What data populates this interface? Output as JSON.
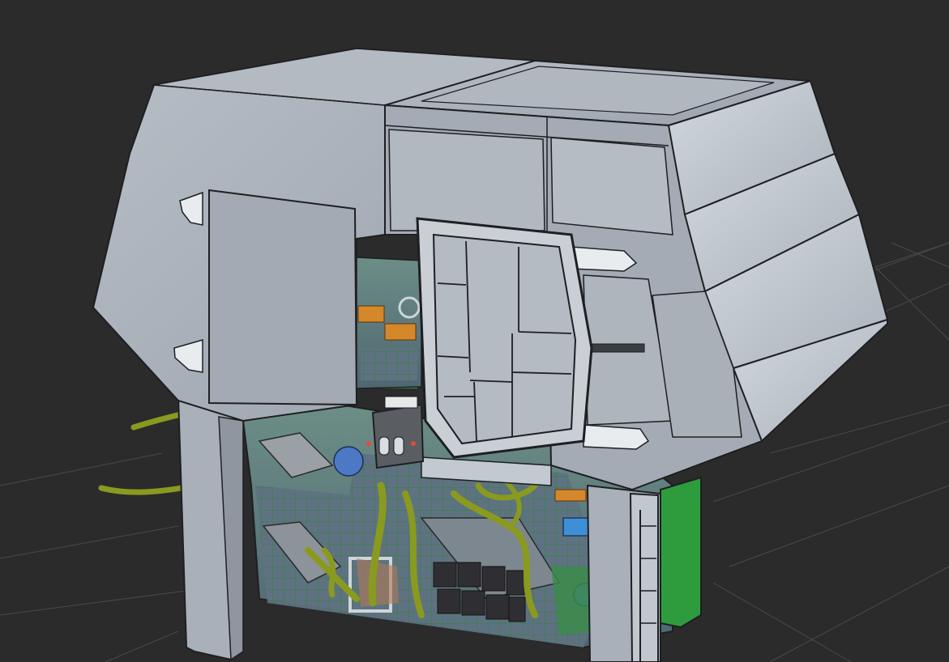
{
  "viewport": {
    "background_color": "#2b2b2b",
    "grid_color": "#4a4a4a"
  },
  "model": {
    "shell_color": "#a9b0b9",
    "shell_dark": "#8f96a0",
    "panel_light": "#c8cfd7",
    "outline_color": "#1e1f22",
    "interior_wall_color": "#6f8f8a",
    "interior_floor_color": "#5d6d7a",
    "pipe_color": "#8a9a1f",
    "green_wall_color": "#2e9c3c",
    "orange_seat_color": "#d4882a",
    "blue_sphere_color": "#4d78c4"
  }
}
